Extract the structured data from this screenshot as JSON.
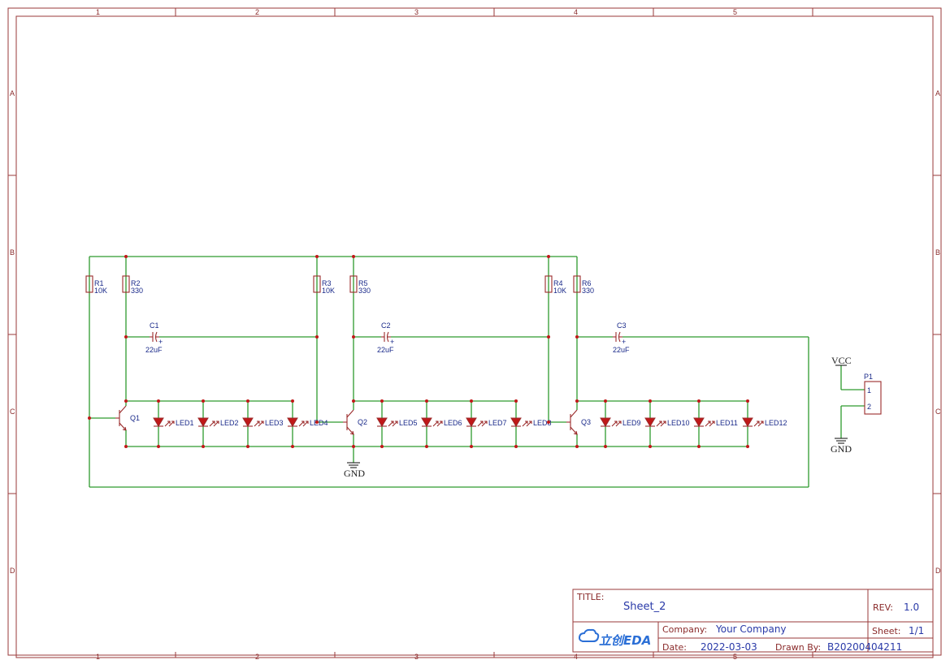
{
  "frame": {
    "columns": [
      "1",
      "2",
      "3",
      "4",
      "5"
    ],
    "rows": [
      "A",
      "B",
      "C",
      "D"
    ]
  },
  "components": {
    "resistors": [
      {
        "ref": "R1",
        "value": "10K"
      },
      {
        "ref": "R2",
        "value": "330"
      },
      {
        "ref": "R3",
        "value": "10K"
      },
      {
        "ref": "R5",
        "value": "330"
      },
      {
        "ref": "R4",
        "value": "10K"
      },
      {
        "ref": "R6",
        "value": "330"
      }
    ],
    "capacitors": [
      {
        "ref": "C1",
        "value": "22uF"
      },
      {
        "ref": "C2",
        "value": "22uF"
      },
      {
        "ref": "C3",
        "value": "22uF"
      }
    ],
    "transistors": [
      "Q1",
      "Q2",
      "Q3"
    ],
    "leds": [
      "LED1",
      "LED2",
      "LED3",
      "LED4",
      "LED5",
      "LED6",
      "LED7",
      "LED8",
      "LED9",
      "LED10",
      "LED11",
      "LED12"
    ],
    "connector": {
      "ref": "P1",
      "pins": [
        "1",
        "2"
      ]
    },
    "power": {
      "vcc": "VCC",
      "gnd": "GND"
    }
  },
  "title_block": {
    "title_label": "TITLE:",
    "title": "Sheet_2",
    "rev_label": "REV:",
    "rev": "1.0",
    "logo_text": "立创EDA",
    "company_label": "Company:",
    "company": "Your Company",
    "sheet_label": "Sheet:",
    "sheet": "1/1",
    "date_label": "Date:",
    "date": "2022-03-03",
    "drawn_by_label": "Drawn By:",
    "drawn_by": "B20200404211"
  },
  "colors": {
    "wire": "#2e9a2e",
    "part": "#9a2a2a",
    "label": "#1a2a8a",
    "junction": "#c01818",
    "logo": "#2b6fd6"
  }
}
